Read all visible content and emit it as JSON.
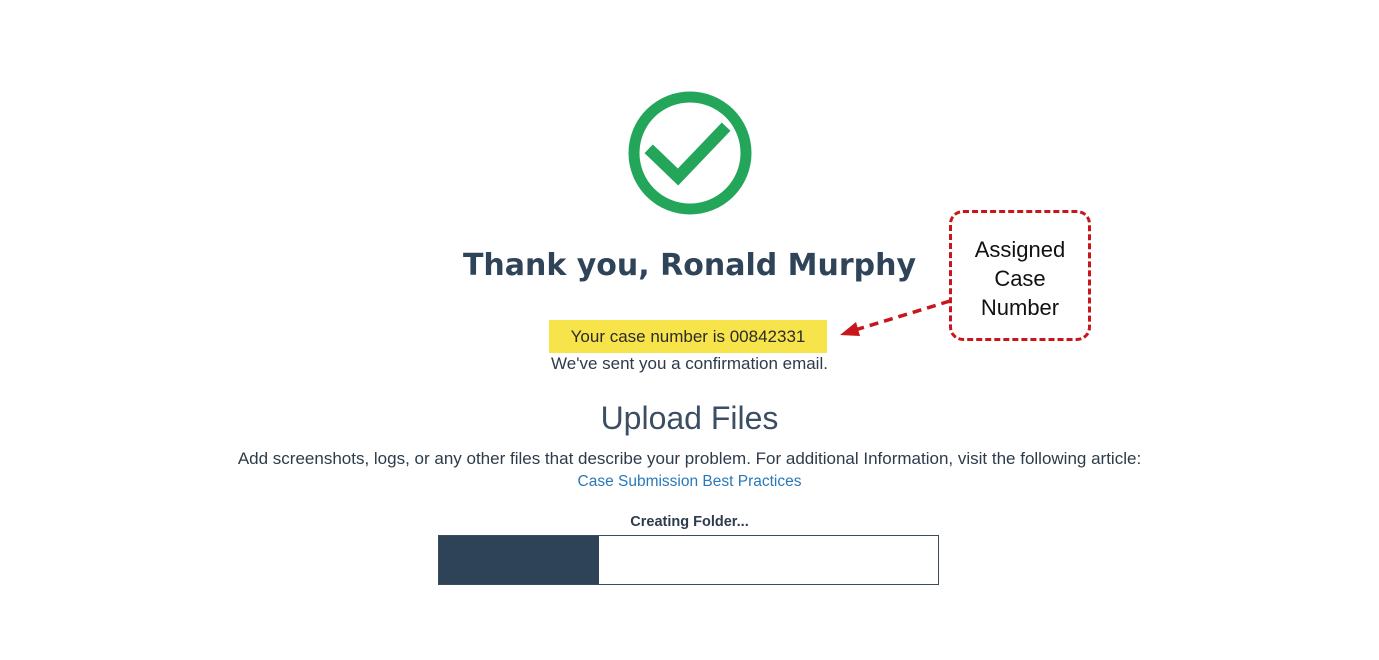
{
  "header": {
    "greeting": "Thank you,",
    "user_name": "Ronald Murphy",
    "success_icon": "check-circle-icon"
  },
  "case": {
    "label": "Your case number is",
    "number": "00842331"
  },
  "confirmation_text": "We've sent you a confirmation email.",
  "upload": {
    "title": "Upload Files",
    "description": "Add screenshots, logs, or any other files that describe your problem. For additional Information, visit the following article:",
    "link_text": "Case Submission Best Practices"
  },
  "progress": {
    "label": "Creating Folder...",
    "fraction": 0.32
  },
  "annotation": {
    "lines": [
      "Assigned",
      "Case",
      "Number"
    ]
  },
  "colors": {
    "success_green": "#23a55a",
    "heading_navy": "#2f4459",
    "highlight_yellow": "#f7e34a",
    "link_blue": "#2a78b8",
    "progress_fill": "#2e4357",
    "annotation_red": "#c8161d"
  }
}
